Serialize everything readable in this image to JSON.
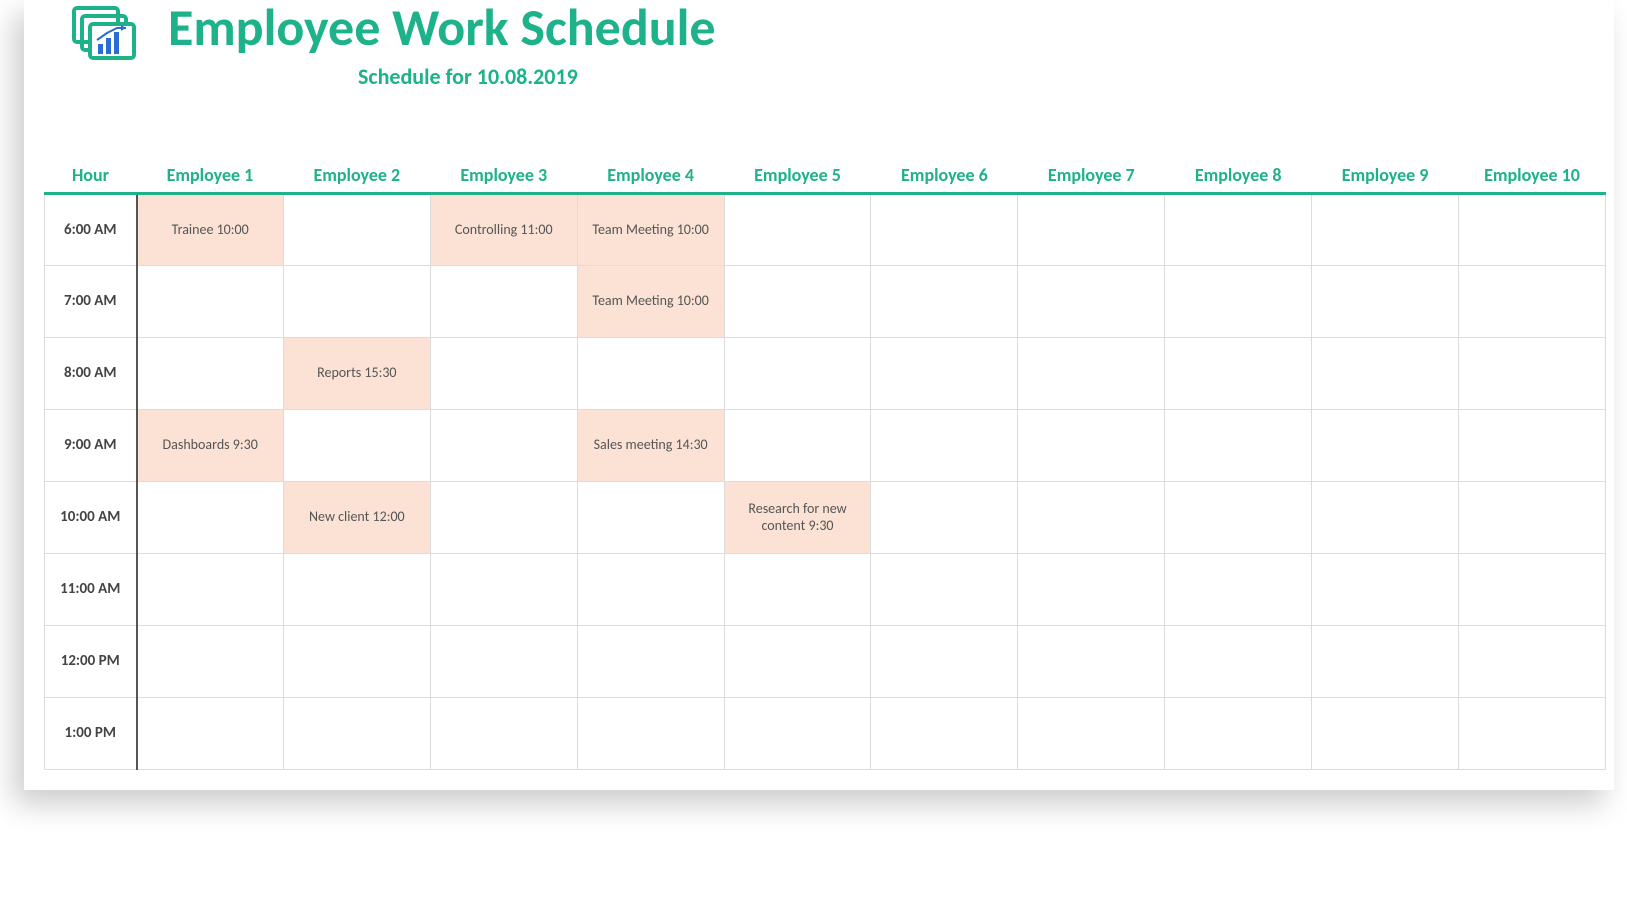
{
  "header": {
    "title": "Employee Work Schedule",
    "subtitle": "Schedule for 10.08.2019"
  },
  "columns": {
    "hour": "Hour",
    "employees": [
      "Employee 1",
      "Employee 2",
      "Employee 3",
      "Employee 4",
      "Employee 5",
      "Employee 6",
      "Employee 7",
      "Employee 8",
      "Employee 9",
      "Employee 10"
    ]
  },
  "hours": [
    "6:00 AM",
    "7:00 AM",
    "8:00 AM",
    "9:00 AM",
    "10:00 AM",
    "11:00 AM",
    "12:00 PM",
    "1:00 PM"
  ],
  "cells": {
    "r0": {
      "e1": "Trainee 10:00",
      "e3": "Controlling 11:00",
      "e4": "Team Meeting 10:00"
    },
    "r1": {
      "e4": "Team Meeting 10:00"
    },
    "r2": {
      "e2": "Reports 15:30"
    },
    "r3": {
      "e1": "Dashboards 9:30",
      "e4": "Sales meeting 14:30"
    },
    "r4": {
      "e2": "New client 12:00",
      "e5": "Research for new content 9:30"
    }
  },
  "colors": {
    "accent": "#1db28a",
    "fill": "#fbe2d5"
  }
}
